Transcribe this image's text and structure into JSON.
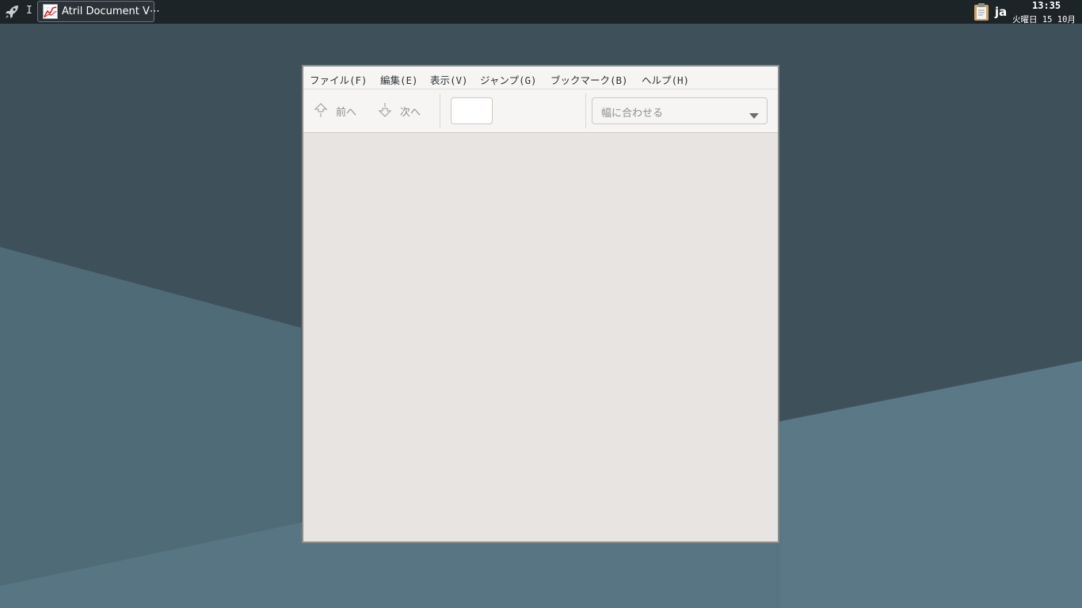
{
  "panel": {
    "launcher_icon": "rocket-icon",
    "separator": "I",
    "taskbar": {
      "title": "Atril Document V⋯",
      "icon": "atril-chart-icon"
    },
    "clipboard_icon": "clipboard-icon",
    "language": "ja",
    "clock": {
      "time": "13:35",
      "date": "火曜日 15 10月"
    }
  },
  "window": {
    "menu": [
      {
        "label": "ファイル(F)"
      },
      {
        "label": "編集(E)"
      },
      {
        "label": "表示(V)"
      },
      {
        "label": "ジャンプ(G)"
      },
      {
        "label": "ブックマーク(B)"
      },
      {
        "label": "ヘルプ(H)"
      }
    ],
    "toolbar": {
      "prev_label": "前へ",
      "next_label": "次へ",
      "page_value": "",
      "zoom_value": "幅に合わせる"
    }
  },
  "colors": {
    "panel_bg": "#1d2428",
    "desktop_dark": "#3f525d",
    "desktop_light": "#56707e",
    "window_bg": "#e8e4e1",
    "toolbar_bg": "#f6f5f4"
  }
}
